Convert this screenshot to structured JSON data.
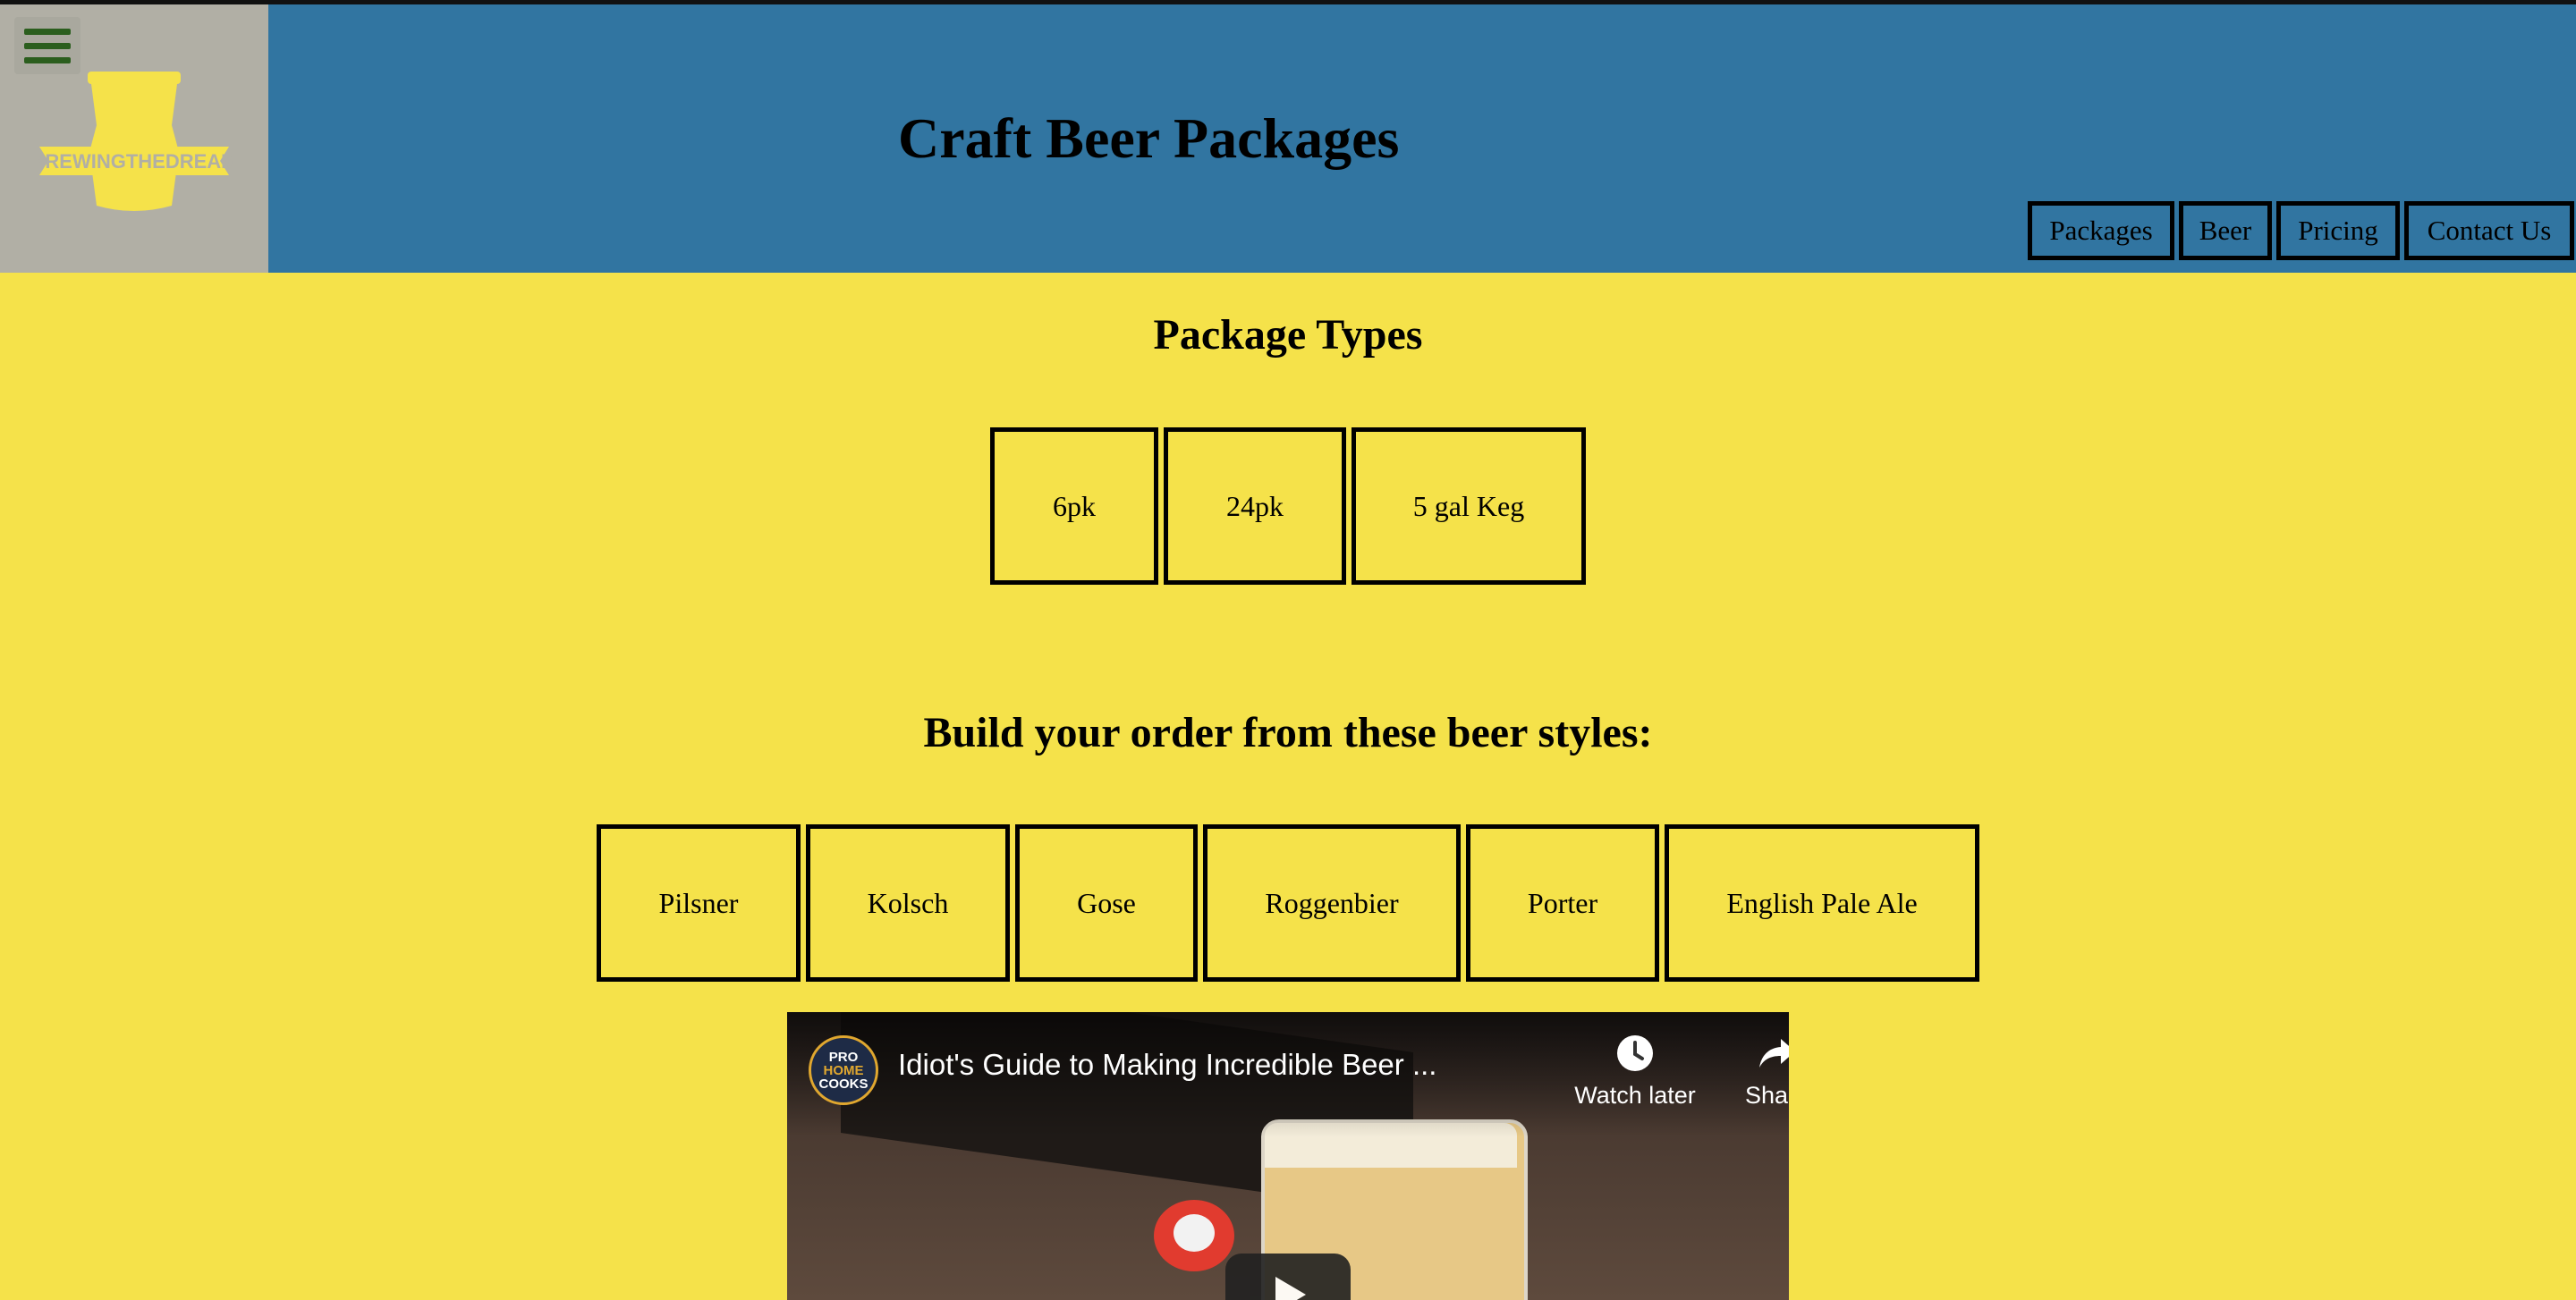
{
  "header": {
    "title": "Craft Beer Packages",
    "logo_text": "BREWINGTHEDREAM",
    "menu_icon": "hamburger-icon"
  },
  "nav": {
    "items": [
      {
        "label": "Packages"
      },
      {
        "label": "Beer"
      },
      {
        "label": "Pricing"
      },
      {
        "label": "Contact Us"
      }
    ]
  },
  "packages": {
    "heading": "Package Types",
    "items": [
      {
        "label": "6pk"
      },
      {
        "label": "24pk"
      },
      {
        "label": "5 gal Keg"
      }
    ]
  },
  "styles": {
    "heading": "Build your order from these beer styles:",
    "items": [
      {
        "label": "Pilsner"
      },
      {
        "label": "Kolsch"
      },
      {
        "label": "Gose"
      },
      {
        "label": "Roggenbier"
      },
      {
        "label": "Porter"
      },
      {
        "label": "English Pale Ale"
      }
    ]
  },
  "video": {
    "title": "Idiot's Guide to Making Incredible Beer ...",
    "channel_logo_lines": [
      "PRO",
      "HOME",
      "COOKS"
    ],
    "watch_later_label": "Watch later",
    "share_label": "Share"
  },
  "colors": {
    "header_bg": "#3175a1",
    "page_bg": "#f5e24a",
    "logo_bg": "#b1afa5",
    "menu_icon": "#2b5e1e"
  }
}
